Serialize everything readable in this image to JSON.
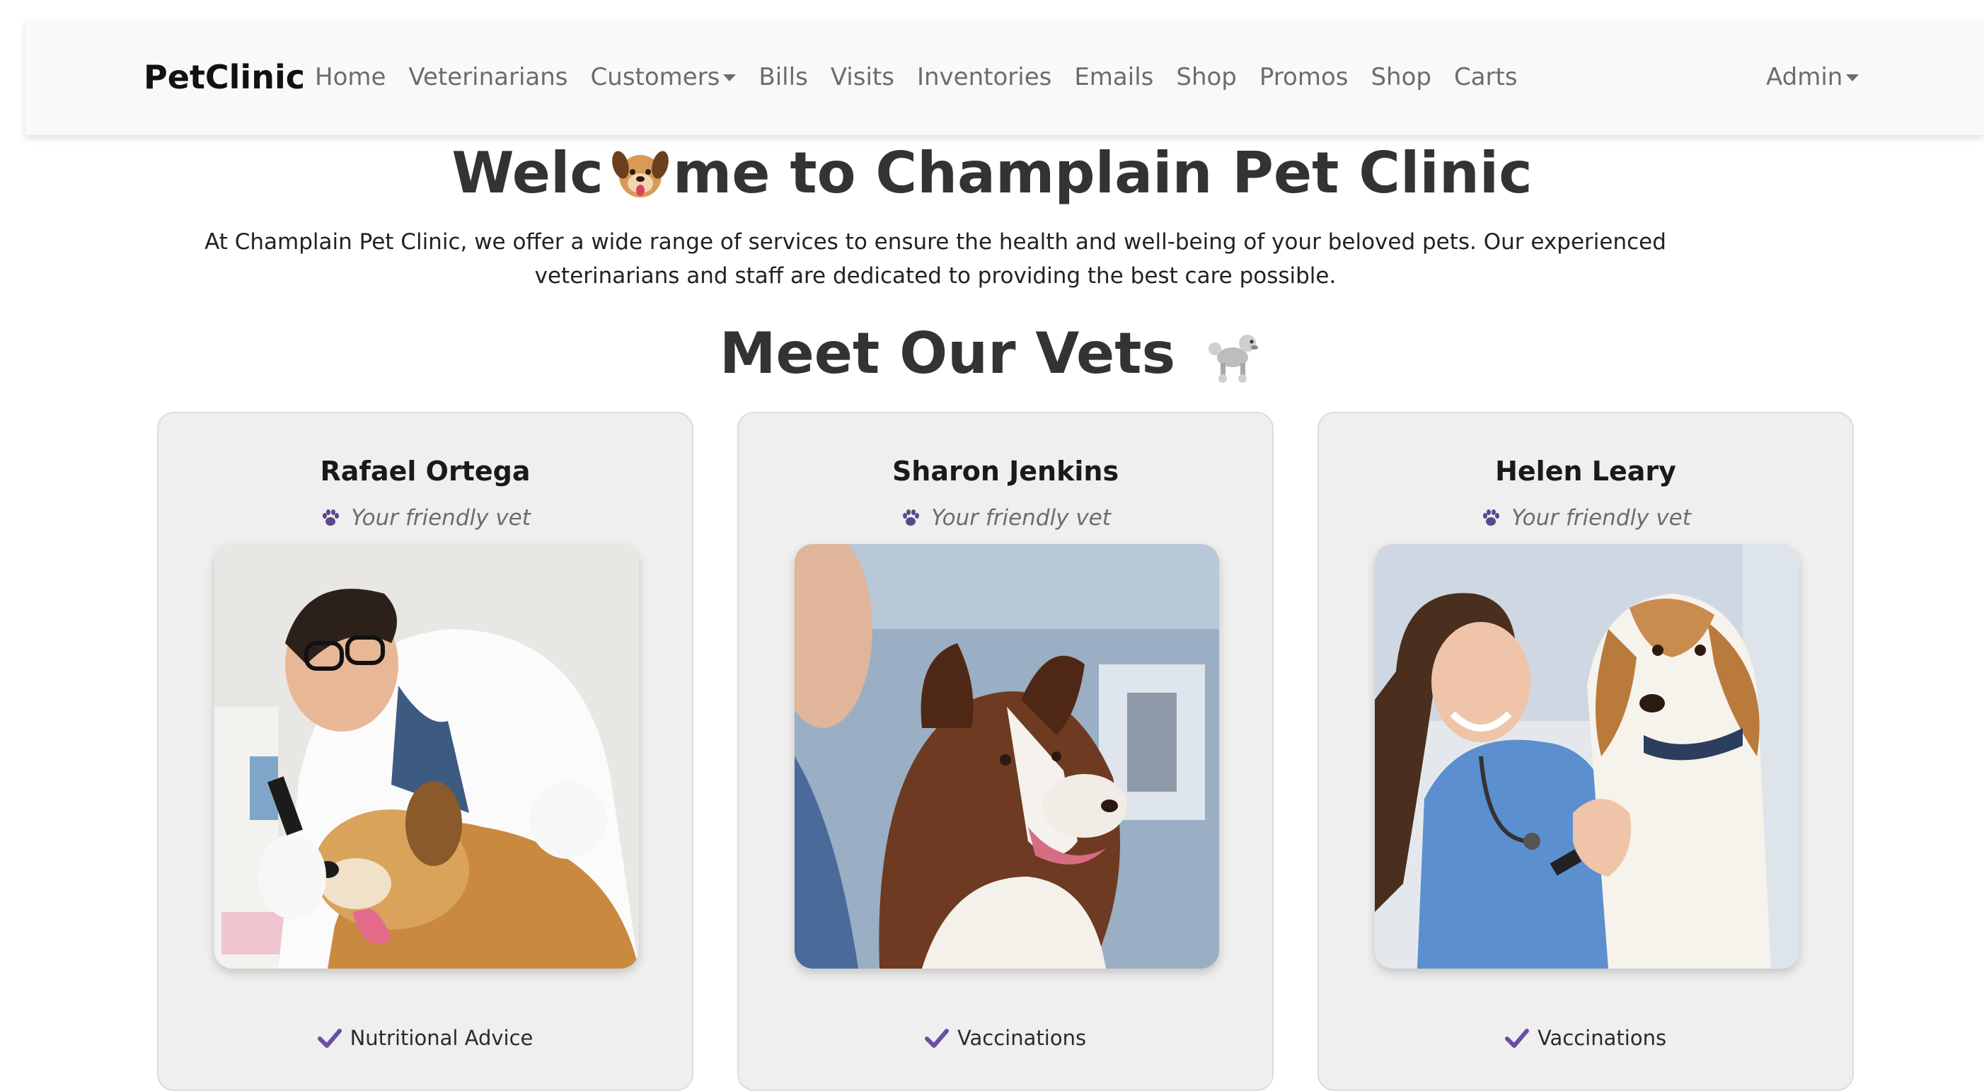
{
  "navbar": {
    "brand": "PetClinic",
    "links": [
      {
        "label": "Home",
        "dropdown": false
      },
      {
        "label": "Veterinarians",
        "dropdown": false
      },
      {
        "label": "Customers",
        "dropdown": true
      },
      {
        "label": "Bills",
        "dropdown": false
      },
      {
        "label": "Visits",
        "dropdown": false
      },
      {
        "label": "Inventories",
        "dropdown": false
      },
      {
        "label": "Emails",
        "dropdown": false
      },
      {
        "label": "Shop",
        "dropdown": false
      },
      {
        "label": "Promos",
        "dropdown": false
      },
      {
        "label": "Shop",
        "dropdown": false
      },
      {
        "label": "Carts",
        "dropdown": false
      }
    ],
    "admin": "Admin"
  },
  "hero": {
    "title_before": "Welc",
    "title_icon": "dog-face-icon",
    "title_after": "me to Champlain Pet Clinic",
    "intro": "At Champlain Pet Clinic, we offer a wide range of services to ensure the health and well-being of your beloved pets. Our experienced veterinarians and staff are dedicated to providing the best care possible."
  },
  "vets_section": {
    "title": "Meet Our Vets",
    "title_icon": "poodle-icon"
  },
  "vets": [
    {
      "name": "Rafael Ortega",
      "subtitle": "Your friendly vet",
      "service": "Nutritional Advice",
      "photo": "vet-with-golden-dog-photo"
    },
    {
      "name": "Sharon Jenkins",
      "subtitle": "Your friendly vet",
      "service": "Vaccinations",
      "photo": "border-collie-photo"
    },
    {
      "name": "Helen Leary",
      "subtitle": "Your friendly vet",
      "service": "Vaccinations",
      "photo": "vet-with-beagle-photo"
    }
  ],
  "colors": {
    "navbar_bg": "#f8f9fa",
    "nav_text": "#6c6c6c",
    "card_bg": "#efefef",
    "accent_purple": "#6a4fa3"
  }
}
